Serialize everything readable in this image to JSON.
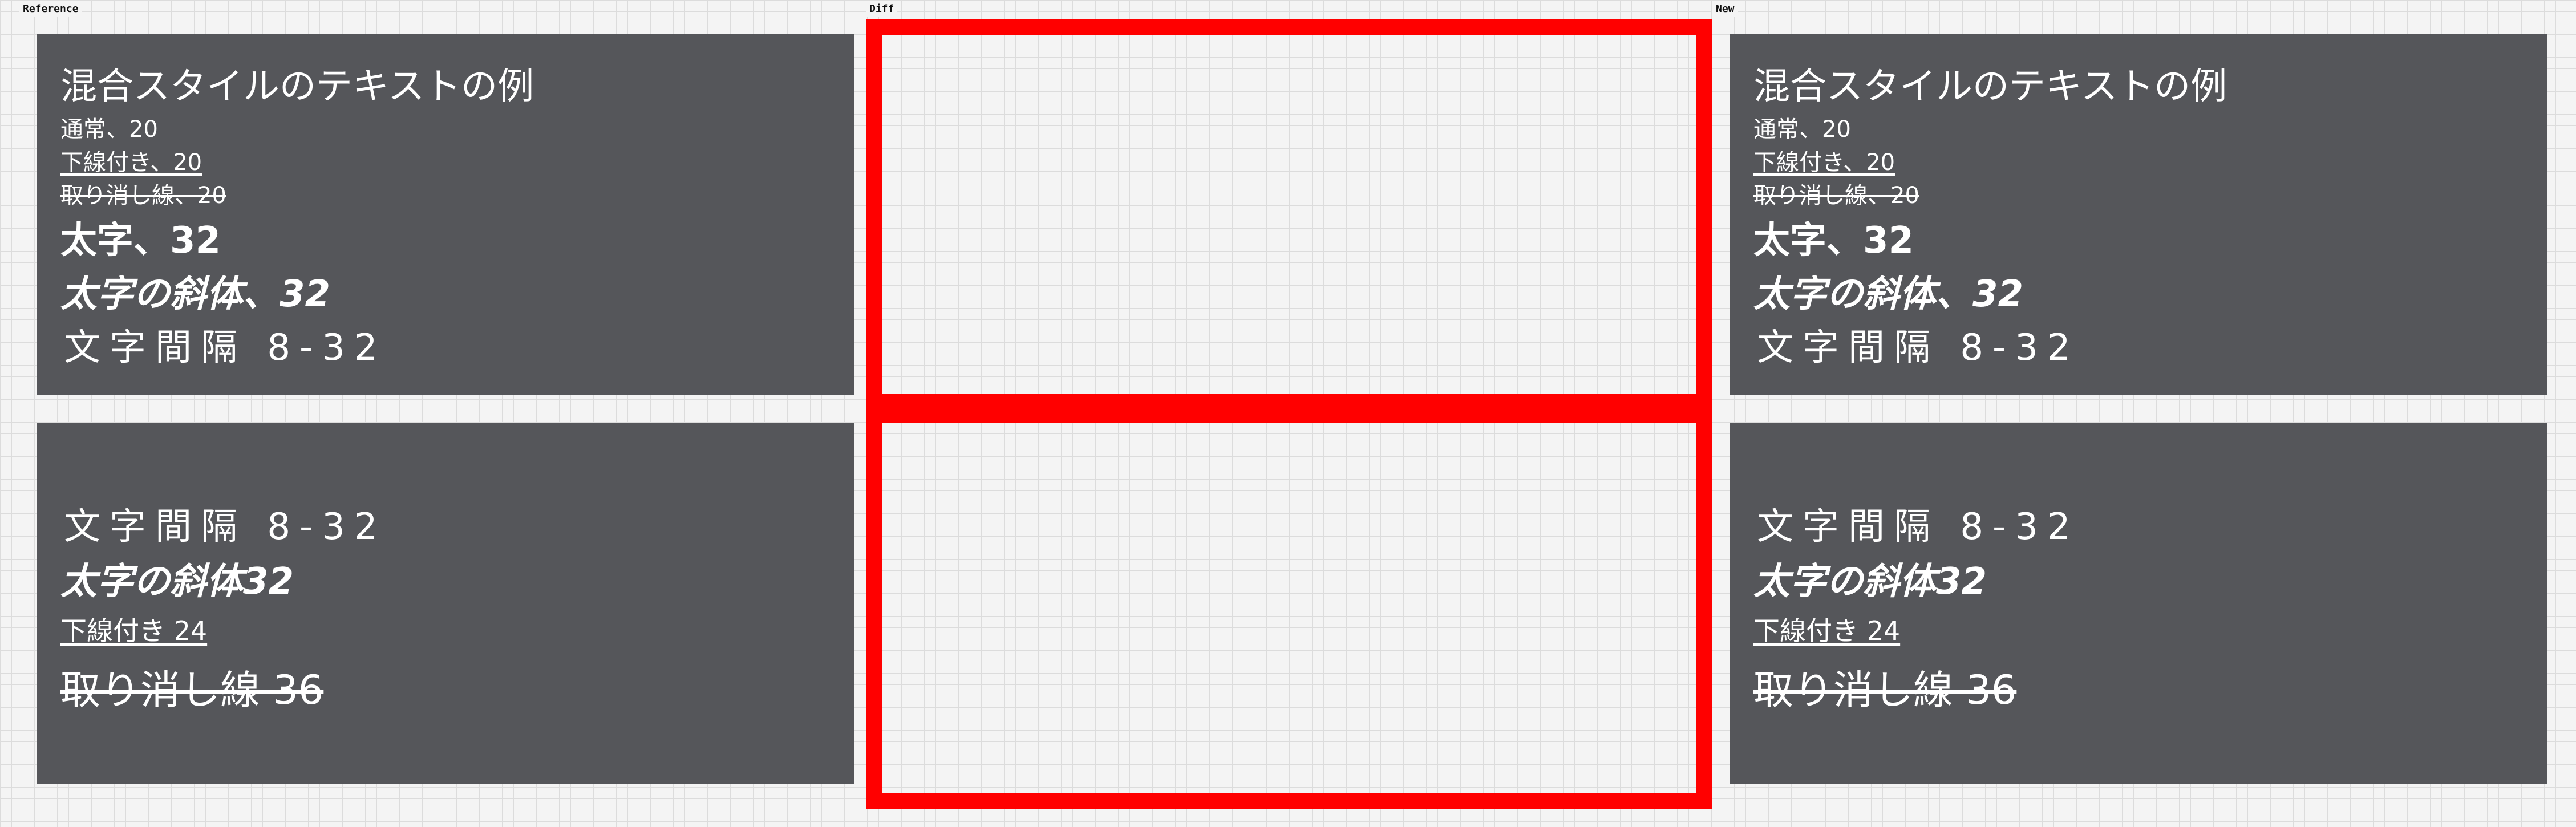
{
  "labels": {
    "reference": "Reference",
    "diff": "Diff",
    "new": "New"
  },
  "colors": {
    "panel_bg": "#55565a",
    "text": "#ffffff",
    "diff_border": "#ff0000",
    "canvas_bg": "#f4f4f4"
  },
  "top_panel": {
    "title": "混合スタイルのテキストの例",
    "normal": "通常、20",
    "underline": "下線付き、20",
    "strike": "取り消し線、20",
    "bold": "太字、32",
    "bold_italic": "太字の斜体、32",
    "spacing": "文字間隔 8-32"
  },
  "bottom_panel": {
    "spacing": "文字間隔 8-32",
    "bold_italic": "太字の斜体32",
    "underline": "下線付き 24",
    "strike": "取り消し線 36"
  }
}
